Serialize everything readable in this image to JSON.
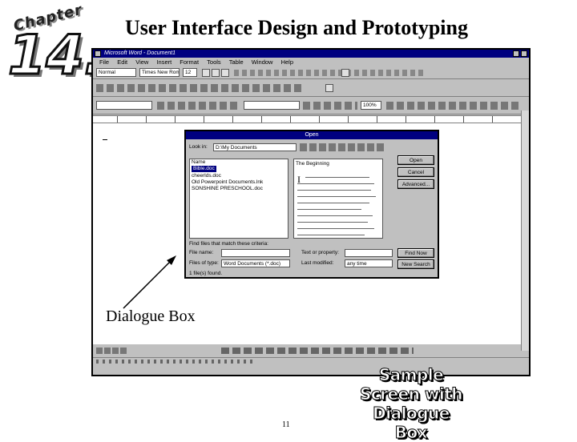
{
  "slide": {
    "title": "User Interface Design and Prototyping",
    "chapter_word": "Chapter",
    "chapter_number": "14.",
    "callout": "Dialogue Box",
    "sample_caption_lines": [
      "Sample",
      "Screen with",
      "Dialogue Box"
    ],
    "page_number": "11"
  },
  "word_window": {
    "title": "Microsoft Word - Document1",
    "menu": [
      "File",
      "Edit",
      "View",
      "Insert",
      "Format",
      "Tools",
      "Table",
      "Window",
      "Help"
    ],
    "style_box": "Normal",
    "font_box": "Times New Roman",
    "size_box": "12",
    "zoom_box": "100%"
  },
  "open_dialog": {
    "title": "Open",
    "look_in_label": "Look in:",
    "look_in_value": "D:\\My Documents",
    "files": [
      {
        "name": "Bible.doc",
        "selected": true
      },
      {
        "name": "cheerlds.doc",
        "selected": false
      },
      {
        "name": "Old Powerpoint Documents.lnk",
        "selected": false
      },
      {
        "name": "SONSHINE PRESCHOOL.doc",
        "selected": false
      }
    ],
    "name_header": "Name",
    "preview_heading": "The Beginning",
    "buttons": {
      "open": "Open",
      "cancel": "Cancel",
      "advanced": "Advanced...",
      "find_now": "Find Now",
      "new_search": "New Search"
    },
    "criteria_label": "Find files that match these criteria:",
    "file_name_label": "File name:",
    "file_type_label": "Files of type:",
    "file_type_value": "Word Documents (*.doc)",
    "text_property_label": "Text or property:",
    "last_modified_label": "Last modified:",
    "last_modified_value": "any time",
    "status_text": "1 file(s) found."
  }
}
